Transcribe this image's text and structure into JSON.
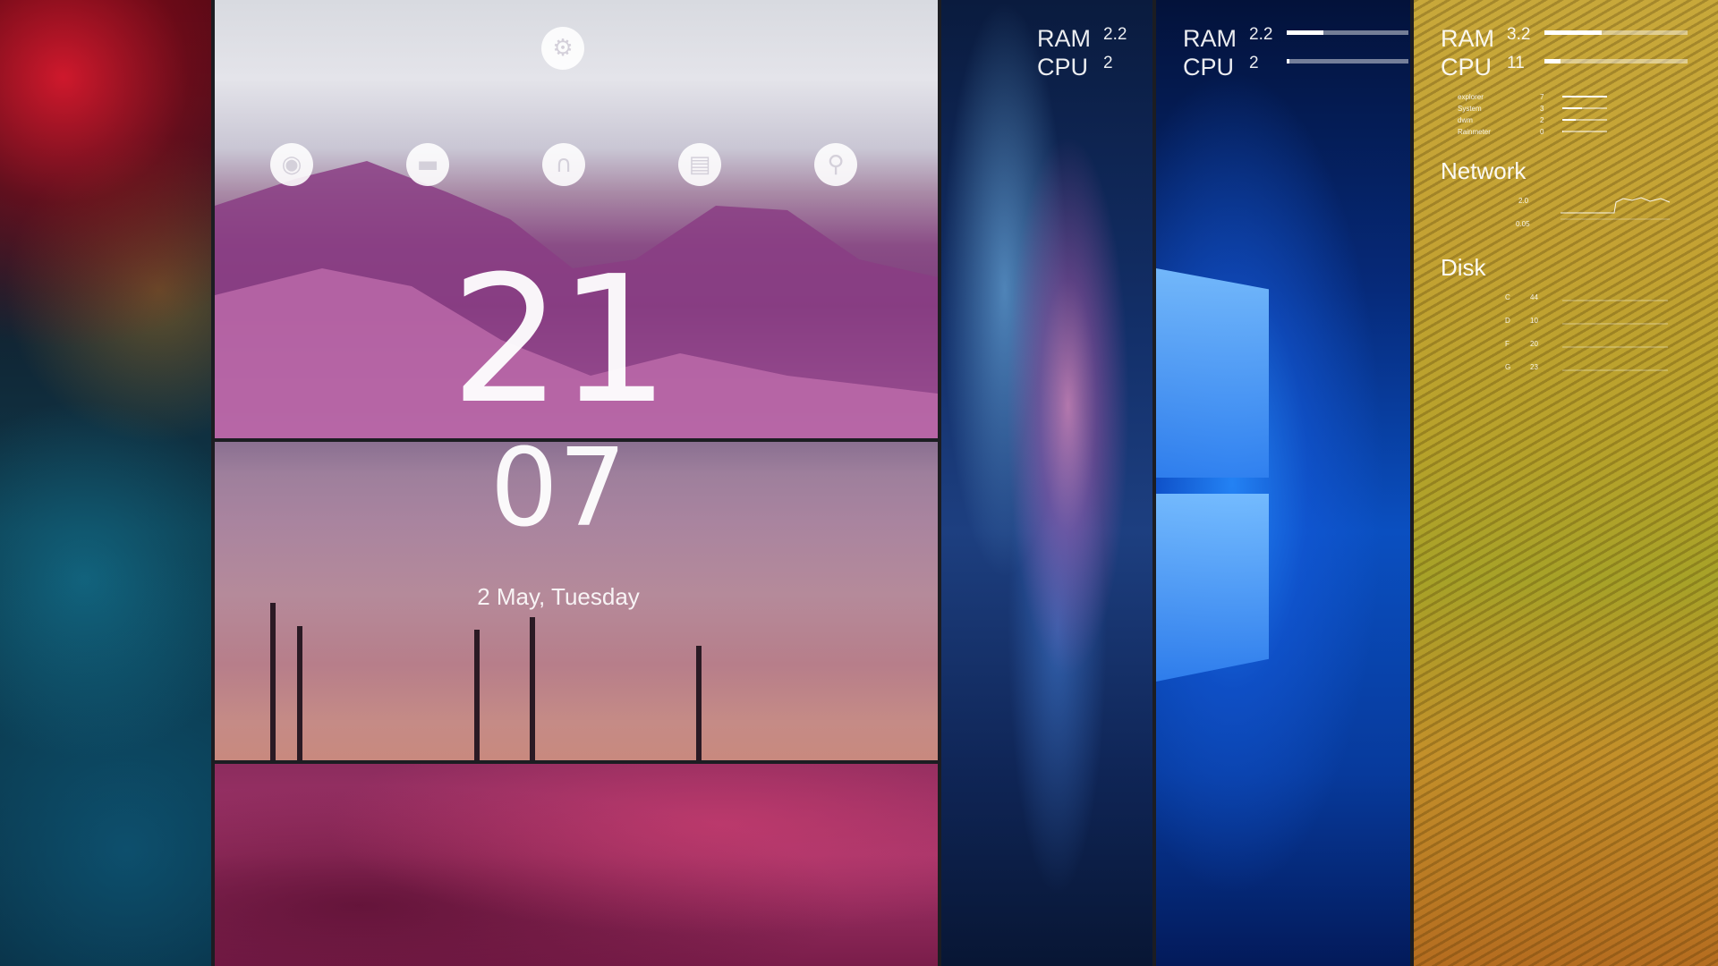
{
  "launcher": {
    "settings_icon": "gear-icon",
    "apps": [
      {
        "name": "firefox",
        "icon": "firefox-icon"
      },
      {
        "name": "files",
        "icon": "folder-icon"
      },
      {
        "name": "music",
        "icon": "headphones-icon"
      },
      {
        "name": "documents",
        "icon": "document-icon"
      },
      {
        "name": "steam",
        "icon": "steam-icon"
      }
    ]
  },
  "clock": {
    "hour": "21",
    "minute": "07",
    "date": "2 May, Tuesday"
  },
  "meters": [
    {
      "ram_label": "RAM",
      "ram_value": "2.2",
      "cpu_label": "CPU",
      "cpu_value": "2"
    },
    {
      "ram_label": "RAM",
      "ram_value": "2.2",
      "cpu_label": "CPU",
      "cpu_value": "2",
      "ram_level": 0.3,
      "cpu_level": 0.02
    },
    {
      "ram_label": "RAM",
      "ram_value": "3.2",
      "cpu_label": "CPU",
      "cpu_value": "11",
      "ram_level": 0.4,
      "cpu_level": 0.11
    }
  ],
  "processes": [
    {
      "name": "explorer",
      "value": "7",
      "level": 1.0
    },
    {
      "name": "System",
      "value": "3",
      "level": 0.43
    },
    {
      "name": "dwm",
      "value": "2",
      "level": 0.29
    },
    {
      "name": "Rainmeter",
      "value": "0",
      "level": 0.02
    }
  ],
  "network": {
    "title": "Network",
    "up": "2.0",
    "down": "0.05"
  },
  "disk": {
    "title": "Disk",
    "drives": [
      {
        "letter": "C",
        "value": "44"
      },
      {
        "letter": "D",
        "value": "10"
      },
      {
        "letter": "F",
        "value": "20"
      },
      {
        "letter": "G",
        "value": "23"
      }
    ]
  },
  "colors": {
    "gold_panel": "#b8a22b",
    "windows_blue": "#0a4fc0",
    "text": "#ffffff"
  }
}
